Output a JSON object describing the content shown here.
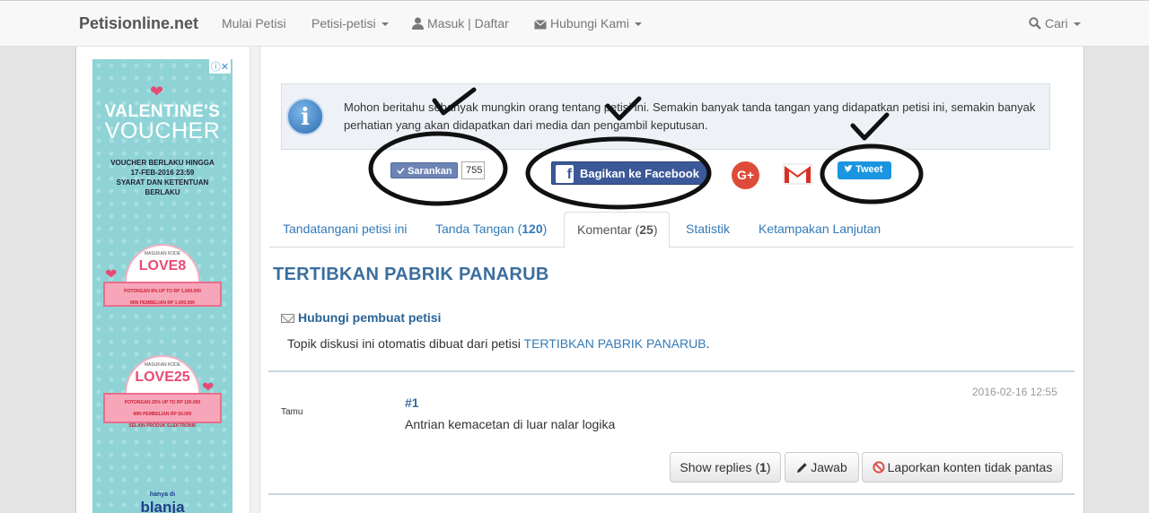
{
  "navbar": {
    "brand": "Petisionline.net",
    "items": [
      "Mulai Petisi",
      "Petisi-petisi",
      "Masuk | Daftar",
      "Hubungi Kami",
      "Cari"
    ]
  },
  "ad": {
    "title1": "VALENTINE'S",
    "title2": "VOUCHER",
    "terms": [
      "VOUCHER BERLAKU HINGGA",
      "17-FEB-2016 23:59",
      "SYARAT DAN KETENTUAN",
      "BERLAKU"
    ],
    "kode_label": "MASUKAN KODE",
    "code1": "LOVE8",
    "code1_detail": [
      "POTONGAN 8% UP TO RP 1.000.000",
      "MIN PEMBELIAN RP 1.000.000"
    ],
    "code2": "LOVE25",
    "code2_detail": [
      "POTONGAN 25% UP TO RP 100.000",
      "MIN PEMBELIAN RP 50.000",
      "SELAIN PRODUK ELEKTRONIK"
    ],
    "footer_small": "hanya di",
    "footer_brand": "blanja"
  },
  "info": {
    "text": "Mohon beritahu sebanyak mungkin orang tentang petisi ini. Semakin banyak tanda tangan yang didapatkan petisi ini, semakin banyak perhatian yang akan didapatkan dari media dan pengambil keputusan."
  },
  "share": {
    "recommend_label": "Sarankan",
    "recommend_count": "755",
    "facebook_label": "Bagikan ke Facebook",
    "tweet_label": "Tweet",
    "gplus_label": "G+"
  },
  "tabs": [
    {
      "label": "Tandatangani petisi ini",
      "count": ""
    },
    {
      "label": "Tanda Tangan (",
      "count": "120",
      "close": ")"
    },
    {
      "label": "Komentar (",
      "count": "25",
      "close": ")"
    },
    {
      "label": "Statistik",
      "count": ""
    },
    {
      "label": "Ketampakan Lanjutan",
      "count": ""
    }
  ],
  "petition": {
    "title": "TERTIBKAN PABRIK PANARUB",
    "contact_label": "Hubungi pembuat petisi",
    "topic_prefix": "Topik diskusi ini otomatis dibuat dari petisi ",
    "topic_link": "TERTIBKAN PABRIK PANARUB",
    "topic_suffix": "."
  },
  "post": {
    "author": "Tamu",
    "number": "#1",
    "date": "2016-02-16 12:55",
    "body": "Antrian kemacetan di luar nalar logika"
  },
  "actions": {
    "replies_prefix": "Show replies (",
    "replies_count": "1",
    "replies_suffix": ")",
    "reply_label": "Jawab",
    "report_label": "Laporkan konten tidak pantas"
  }
}
